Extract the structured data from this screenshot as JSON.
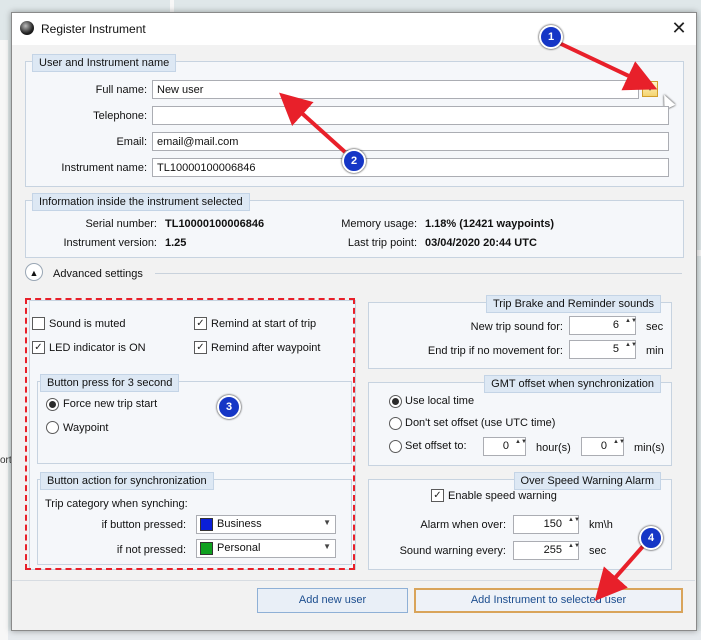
{
  "window": {
    "title": "Register Instrument",
    "close_glyph": "✕"
  },
  "user_section": {
    "legend": "User and Instrument name",
    "full_name_label": "Full name:",
    "full_name_value": "New user",
    "telephone_label": "Telephone:",
    "telephone_value": "",
    "email_label": "Email:",
    "email_value": "email@mail.com",
    "instrument_label": "Instrument name:",
    "instrument_value": "TL10000100006846"
  },
  "info_section": {
    "legend": "Information inside the instrument selected",
    "serial_label": "Serial number:",
    "serial_value": "TL10000100006846",
    "version_label": "Instrument version:",
    "version_value": "1.25",
    "memory_label": "Memory usage:",
    "memory_value": "1.18% (12421 waypoints)",
    "lasttrip_label": "Last trip point:",
    "lasttrip_value": "03/04/2020 20:44 UTC"
  },
  "advanced": {
    "label": "Advanced settings",
    "chevron": "▲"
  },
  "options": {
    "sound_muted": {
      "label": "Sound is muted",
      "checked": false
    },
    "remind_start": {
      "label": "Remind at start of trip",
      "checked": true
    },
    "led_on": {
      "label": "LED indicator is ON",
      "checked": true
    },
    "remind_waypoint": {
      "label": "Remind after waypoint",
      "checked": true
    },
    "check_glyph": "✓"
  },
  "button_press": {
    "legend": "Button press for 3 second",
    "option1": "Force new trip start",
    "option2": "Waypoint",
    "selected": "Force new trip start"
  },
  "button_action": {
    "legend": "Button action for synchronization",
    "trip_category_label": "Trip category when synching:",
    "pressed_label": "if button pressed:",
    "pressed_value": "Business",
    "pressed_color": "#0a1fd8",
    "not_pressed_label": "if not pressed:",
    "not_pressed_value": "Personal",
    "not_pressed_color": "#10a020",
    "dropdown_glyph": "▼"
  },
  "trip_brake": {
    "legend": "Trip Brake and Reminder sounds",
    "new_trip_label": "New trip sound for:",
    "new_trip_value": "6",
    "new_trip_unit": "sec",
    "end_trip_label": "End trip if no movement for:",
    "end_trip_value": "5",
    "end_trip_unit": "min",
    "spin_glyph": "▲▼"
  },
  "gmt": {
    "legend": "GMT offset when synchronization",
    "opt_local": "Use local time",
    "opt_utc": "Don't set offset (use UTC time)",
    "opt_set": "Set offset to:",
    "selected": "Use local time",
    "hours_value": "0",
    "hours_unit": "hour(s)",
    "mins_value": "0",
    "mins_unit": "min(s)"
  },
  "speed": {
    "legend": "Over Speed Warning Alarm",
    "enable_label": "Enable speed warning",
    "enabled": true,
    "alarm_label": "Alarm when over:",
    "alarm_value": "150",
    "alarm_unit": "km\\h",
    "sound_label": "Sound warning every:",
    "sound_value": "255",
    "sound_unit": "sec"
  },
  "buttons": {
    "add_user": "Add new user",
    "add_instrument": "Add Instrument to selected user"
  },
  "annotations": {
    "b1": "1",
    "b2": "2",
    "b3": "3",
    "b4": "4"
  },
  "background_map": {
    "text": "ort"
  }
}
